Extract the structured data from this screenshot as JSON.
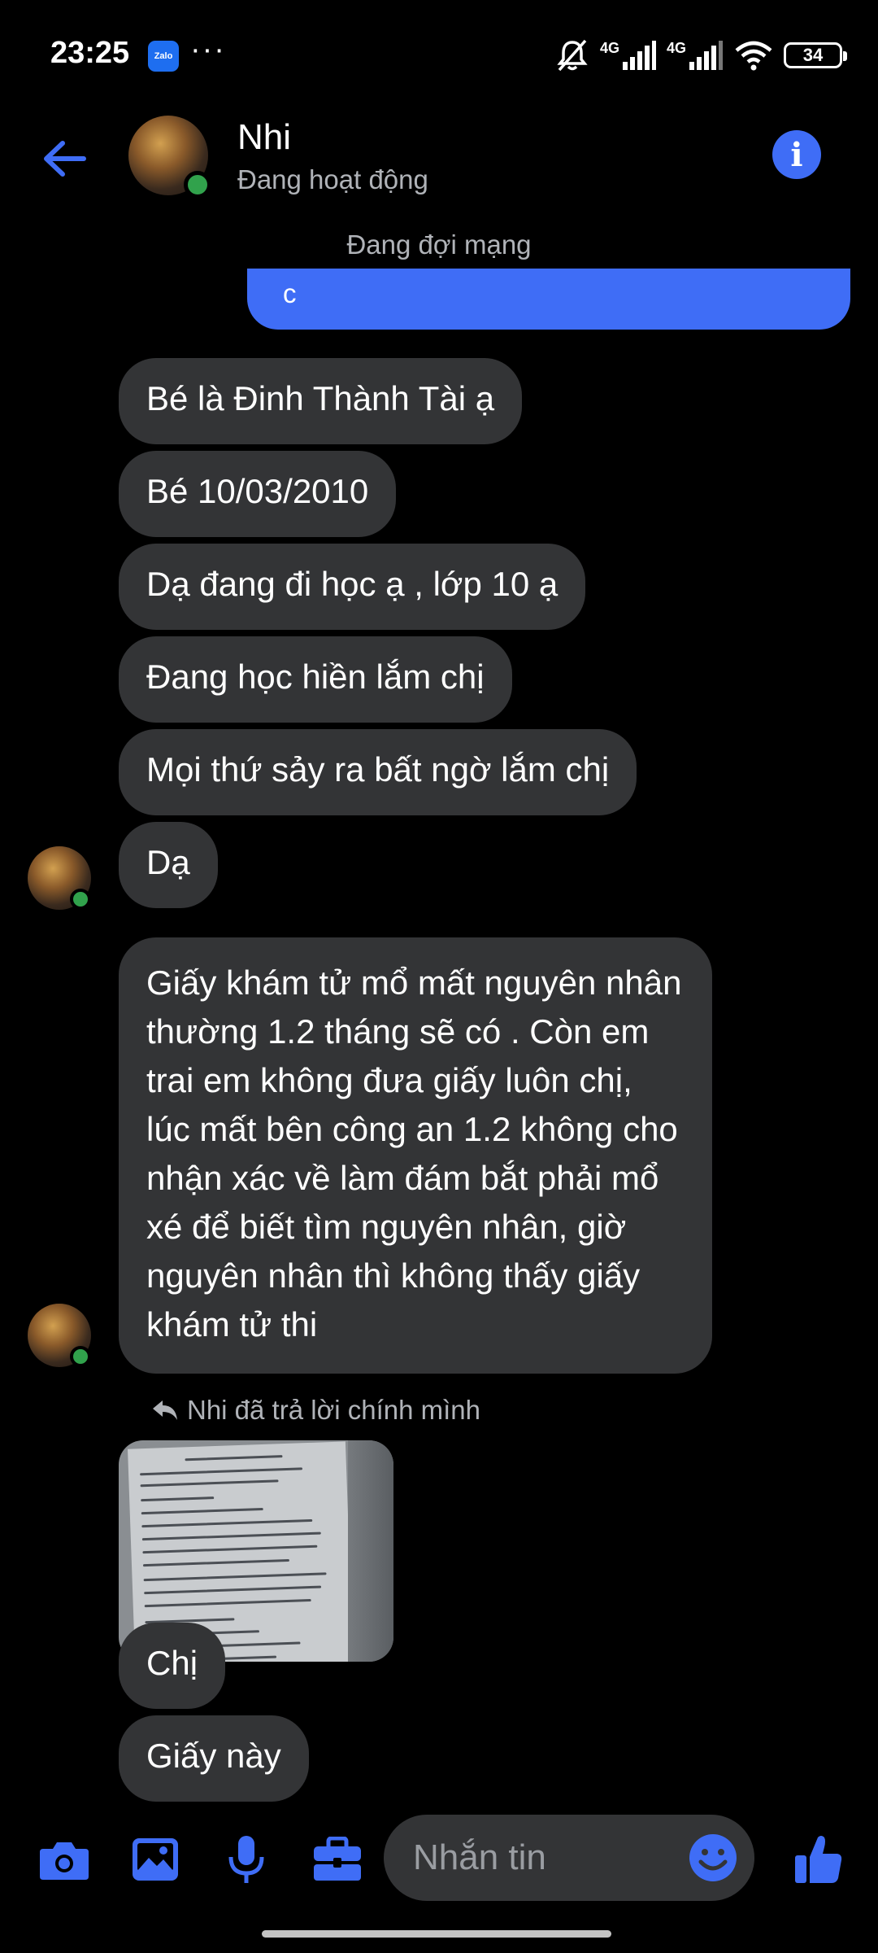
{
  "status_bar": {
    "time": "23:25",
    "zalo_label": "Zalo",
    "dots": "···",
    "net1": "4G",
    "net2": "4G",
    "battery": "34"
  },
  "header": {
    "name": "Nhi",
    "status": "Đang hoạt động",
    "info_glyph": "i"
  },
  "notice": "Đang đợi mạng",
  "sent_partial": "c",
  "messages": [
    "Bé là Đinh Thành Tài ạ",
    "Bé 10/03/2010",
    "Dạ đang đi học ạ , lớp 10 ạ",
    "Đang học hiền lắm chị",
    "Mọi thứ sảy ra bất ngờ lắm chị",
    "Dạ",
    "Giấy khám tử mổ mất nguyên nhân thường 1.2 tháng sẽ có . Còn em trai em không đưa giấy luôn chị, lúc mất bên công an 1.2 không cho nhận xác về làm đám bắt phải mổ xé để biết tìm nguyên nhân, giờ nguyên nhân thì không thấy giấy khám tử thi"
  ],
  "reply_label": "Nhi đã trả lời chính mình",
  "after_image": [
    "Chị",
    "Giấy này"
  ],
  "input": {
    "placeholder": "Nhắn tin"
  },
  "colors": {
    "accent": "#3f6df6",
    "bubble_in": "#333436",
    "online": "#31a24c",
    "background": "#000000"
  },
  "icons": [
    "back-arrow-icon",
    "info-icon",
    "camera-icon",
    "gallery-icon",
    "microphone-icon",
    "briefcase-icon",
    "emoji-icon",
    "thumbs-up-icon",
    "reply-arrow-icon"
  ]
}
